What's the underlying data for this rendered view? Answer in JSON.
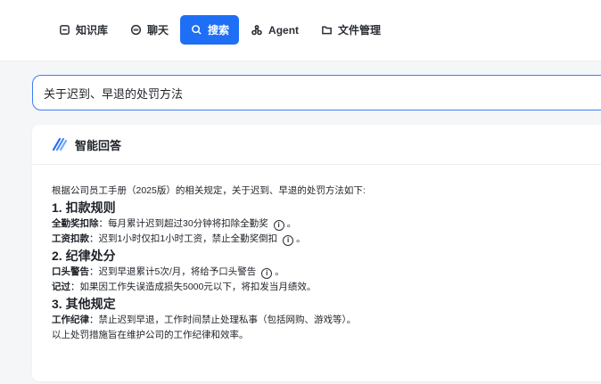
{
  "nav": {
    "tabs": [
      {
        "label": "知识库",
        "icon": "database-icon"
      },
      {
        "label": "聊天",
        "icon": "chat-icon"
      },
      {
        "label": "搜索",
        "icon": "search-icon",
        "active": true
      },
      {
        "label": "Agent",
        "icon": "agent-icon"
      },
      {
        "label": "文件管理",
        "icon": "folder-icon"
      }
    ]
  },
  "search": {
    "value": "关于迟到、早退的处罚方法"
  },
  "answer": {
    "title": "智能回答",
    "intro": "根据公司员工手册（2025版）的相关规定，关于迟到、早退的处罚方法如下:",
    "sections": [
      {
        "heading": "1. 扣款规则",
        "items": [
          {
            "label": "全勤奖扣除",
            "text": "：每月累计迟到超过30分钟将扣除全勤奖",
            "cite": "i",
            "tail": "。"
          },
          {
            "label": "工资扣款",
            "text": "：迟到1小时仅扣1小时工资，禁止全勤奖倒扣",
            "cite": "i",
            "tail": "。"
          }
        ]
      },
      {
        "heading": "2. 纪律处分",
        "items": [
          {
            "label": "口头警告",
            "text": "：迟到早退累计5次/月，将给予口头警告",
            "cite": "i",
            "tail": "。"
          },
          {
            "label": "记过",
            "text": "：如果因工作失误造成损失5000元以下，将扣发当月绩效。",
            "cite": "",
            "tail": ""
          }
        ]
      },
      {
        "heading": "3. 其他规定",
        "items": [
          {
            "label": "工作纪律",
            "text": "：禁止迟到早退，工作时间禁止处理私事（包括网购、游戏等）。",
            "cite": "",
            "tail": ""
          }
        ]
      }
    ],
    "closing": "以上处罚措施旨在维护公司的工作纪律和效率。"
  },
  "colors": {
    "accent": "#1e6ff5",
    "background": "#f5f6f8"
  }
}
